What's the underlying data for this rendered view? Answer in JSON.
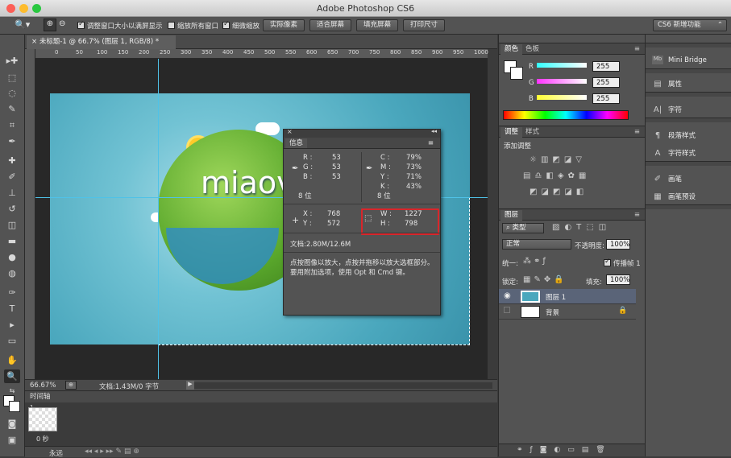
{
  "window": {
    "title": "Adobe Photoshop CS6"
  },
  "options": {
    "resize_windows": "调整窗口大小以满屏显示",
    "zoom_all": "缩放所有窗口",
    "scrubby_zoom": "细微缩放",
    "actual_pixels": "实际像素",
    "fit_screen": "适合屏幕",
    "fill_screen": "填充屏幕",
    "print_size": "打印尺寸",
    "workspace": "CS6 新增功能"
  },
  "document": {
    "tab_title": "未标题-1 @ 66.7% (图层 1, RGB/8) *",
    "zoom": "66.67%",
    "doc_size": "文档:1.43M/0 字节",
    "art_text": "miaov"
  },
  "ruler": {
    "ticks": [
      "0",
      "50",
      "100",
      "150",
      "200",
      "250",
      "300",
      "350",
      "400",
      "450",
      "500",
      "550",
      "600",
      "650",
      "700",
      "750",
      "800",
      "850",
      "900",
      "950",
      "1000"
    ]
  },
  "info": {
    "tab": "信息",
    "r_label": "R :",
    "r": "53",
    "g_label": "G :",
    "g": "53",
    "b_label": "B :",
    "b": "53",
    "bits1": "8 位",
    "c_label": "C :",
    "c": "79%",
    "m_label": "M :",
    "m": "73%",
    "y_label": "Y :",
    "y": "71%",
    "k_label": "K :",
    "k": "43%",
    "bits2": "8 位",
    "x_label": "X :",
    "x": "768",
    "yy_label": "Y :",
    "yy": "572",
    "w_label": "W :",
    "w": "1227",
    "h_label": "H :",
    "h": "798",
    "doc": "文档:2.80M/12.6M",
    "hint": "点按图像以放大，点按并拖移以放大选框部分。要用附加选项，使用 Opt 和 Cmd 键。"
  },
  "color_panel": {
    "tab_color": "颜色",
    "tab_swatches": "色板",
    "r_label": "R",
    "r": "255",
    "g_label": "G",
    "g": "255",
    "b_label": "B",
    "b": "255"
  },
  "adjust_panel": {
    "tab_adjust": "调整",
    "tab_styles": "样式",
    "add_label": "添加调整"
  },
  "layers_panel": {
    "tab": "图层",
    "filter": "类型",
    "blend": "正常",
    "opacity_label": "不透明度:",
    "opacity": "100%",
    "unify_label": "统一:",
    "propagate": "传播帧 1",
    "lock_label": "锁定:",
    "fill_label": "填充:",
    "fill": "100%",
    "layers": [
      {
        "name": "图层 1"
      },
      {
        "name": "背景"
      }
    ]
  },
  "dock": {
    "items": [
      "Mini Bridge",
      "属性",
      "字符",
      "段落样式",
      "字符样式",
      "画笔",
      "画笔预设"
    ]
  },
  "timeline": {
    "tab": "时间轴",
    "frame_no": "1",
    "frame_time": "0 秒",
    "loop": "永远"
  },
  "colors": {
    "accent": "#d8262b",
    "guide": "#4fc2e8"
  }
}
